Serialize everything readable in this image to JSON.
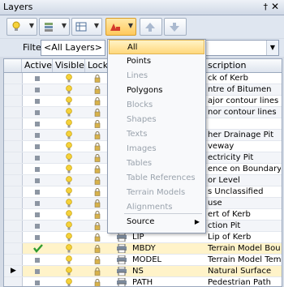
{
  "window": {
    "title": "Layers",
    "pin_glyph": "†",
    "close_glyph": "✕"
  },
  "toolbar": {
    "buttons": [
      {
        "name": "new-layer",
        "icon": "lightbulb-icon",
        "active": false
      },
      {
        "name": "layer-stack",
        "icon": "layers-icon",
        "active": false
      },
      {
        "name": "layer-manager",
        "icon": "layer-table-icon",
        "active": false
      },
      {
        "name": "layer-type-filter",
        "icon": "shapes-filter-icon",
        "active": true
      },
      {
        "name": "move-up",
        "icon": "arrow-up-icon",
        "active": false
      },
      {
        "name": "move-down",
        "icon": "arrow-down-icon",
        "active": false
      }
    ]
  },
  "filter": {
    "label": "Filter:",
    "value": "<All Layers>"
  },
  "grid": {
    "headers": {
      "active": "Active",
      "visible": "Visible",
      "lock": "Lock",
      "description": "scription"
    },
    "rows": [
      {
        "desc": "ck of Kerb",
        "sel": false
      },
      {
        "desc": "ntre of Bitumen",
        "sel": false
      },
      {
        "desc": "ajor contour lines",
        "sel": false
      },
      {
        "desc": "nor contour lines",
        "sel": false
      },
      {
        "desc": "",
        "sel": false
      },
      {
        "desc": "her Drainage Pit",
        "sel": false
      },
      {
        "desc": "veway",
        "sel": false
      },
      {
        "desc": "ectricity Pit",
        "sel": false
      },
      {
        "desc": "ence on Boundary",
        "sel": false
      },
      {
        "desc": "or Level",
        "sel": false
      },
      {
        "desc": "s Unclassified",
        "sel": false
      },
      {
        "desc": "use",
        "sel": false
      },
      {
        "desc": "ert of Kerb",
        "sel": false
      },
      {
        "desc": "ction Pit",
        "sel": false
      },
      {
        "name": "LIP",
        "desc": "Lip of Kerb",
        "sel": false
      },
      {
        "name": "MBDY",
        "desc": "Terrain Model Boundary",
        "sel": true,
        "active_check": true
      },
      {
        "name": "MODEL",
        "desc": "Terrain Model Template",
        "sel": false
      },
      {
        "name": "NS",
        "desc": "Natural Surface",
        "sel": true,
        "current": true
      },
      {
        "name": "PATH",
        "desc": "Pedestrian Path",
        "sel": false
      }
    ]
  },
  "menu": {
    "items": [
      {
        "label": "All",
        "state": "highlight"
      },
      {
        "label": "Points",
        "state": "enabled"
      },
      {
        "label": "Lines",
        "state": "disabled"
      },
      {
        "label": "Polygons",
        "state": "enabled"
      },
      {
        "label": "Blocks",
        "state": "disabled"
      },
      {
        "label": "Shapes",
        "state": "disabled"
      },
      {
        "label": "Texts",
        "state": "disabled"
      },
      {
        "label": "Images",
        "state": "disabled"
      },
      {
        "label": "Tables",
        "state": "disabled"
      },
      {
        "label": "Table References",
        "state": "disabled"
      },
      {
        "label": "Terrain Models",
        "state": "disabled"
      },
      {
        "label": "Alignments",
        "state": "disabled"
      },
      {
        "label": "Source",
        "state": "enabled",
        "submenu": true
      }
    ],
    "submenu_glyph": "▶"
  },
  "colors": {
    "accent": "#ffd87c",
    "selection_row": "#fff3c9",
    "check": "#2e9b2e"
  }
}
